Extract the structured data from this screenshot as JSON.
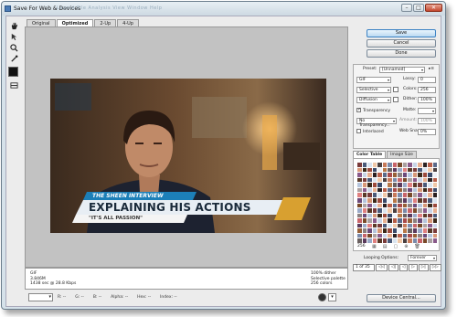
{
  "window": {
    "title": "Save For Web & Devices",
    "menu_ghost": "Layout   File   Analysis   View   Window   Help",
    "controls": {
      "minimize": "–",
      "maximize": "□",
      "close": "✕"
    }
  },
  "tabs": [
    "Original",
    "Optimized",
    "2-Up",
    "4-Up"
  ],
  "image": {
    "banner_small": "THE SHEEN INTERVIEW",
    "banner_main": "EXPLAINING HIS ACTIONS",
    "banner_sub": "\"IT'S ALL PASSION\""
  },
  "info_panel": {
    "left": [
      "GIF",
      "3.846M",
      "1438 sec @ 28.8 Kbps"
    ],
    "right": [
      "100% dither",
      "Selective palette",
      "256 colors"
    ]
  },
  "status_bar": {
    "zoom": "",
    "fields": [
      "R: --",
      "G: --",
      "B: --",
      "Alpha: --",
      "Hex: --",
      "Index: --"
    ]
  },
  "buttons": {
    "save": "Save",
    "cancel": "Cancel",
    "done": "Done",
    "device_central": "Device Central..."
  },
  "settings": {
    "preset_label": "Preset:",
    "preset_value": "[Unnamed]",
    "format": "GIF",
    "lossy_label": "Lossy:",
    "lossy_value": "0",
    "reduction": "Selective",
    "colors_label": "Colors:",
    "colors_value": "256",
    "dither_algo": "Diffusion",
    "dither_label": "Dither:",
    "dither_value": "100%",
    "transparency_label": "Transparency",
    "matte_label": "Matte:",
    "transparency_dither": "No Transparency...",
    "amount_label": "Amount:",
    "amount_value": "100%",
    "interlaced_label": "Interlaced",
    "websnap_label": "Web Snap:",
    "websnap_value": "0%"
  },
  "color_table": {
    "tabs": [
      "Color Table",
      "Image Size"
    ],
    "count": "256",
    "palette": [
      "#7a3b3a",
      "#9c4a3c",
      "#b75d47",
      "#c77a5a",
      "#5b3a5d",
      "#6c4a7a",
      "#8a5a8a",
      "#4a5a7a",
      "#3a4a6a",
      "#5a6a8a",
      "#7a8aaa",
      "#9aaac8",
      "#b5c5dd",
      "#c8d5e8",
      "#dae5f0",
      "#eef2f8",
      "#a84a4a",
      "#c8646a",
      "#e08080",
      "#d89878",
      "#e8b090",
      "#f0c8a8",
      "#b87848",
      "#986038",
      "#784828",
      "#5a3a28",
      "#3a2818",
      "#2a2020",
      "#4a4040",
      "#6a6060",
      "#8a8080",
      "#aaa0a0"
    ],
    "footer_icons": [
      "▦",
      "▤",
      "▢",
      "⊕",
      "🗑"
    ]
  },
  "animation": {
    "looping_label": "Looping Options:",
    "looping_value": "Forever",
    "frame": "1 of 35",
    "controls": [
      "◁◁",
      "◁|",
      "◁",
      "▷",
      "▷|",
      "▷▷"
    ]
  }
}
